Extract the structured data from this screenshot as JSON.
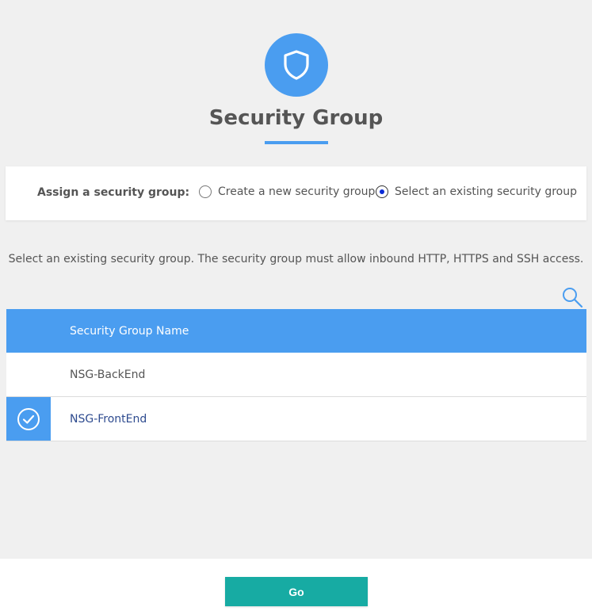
{
  "header": {
    "icon": "shield-icon",
    "title": "Security Group"
  },
  "assign": {
    "label": "Assign a security group:",
    "options": [
      {
        "label": "Create a new security group",
        "selected": false
      },
      {
        "label": "Select an existing security group",
        "selected": true
      }
    ]
  },
  "instructions": "Select an existing security group. The security group must allow inbound HTTP, HTTPS and SSH access.",
  "search": {
    "icon": "search-icon"
  },
  "table": {
    "column_header": "Security Group Name",
    "rows": [
      {
        "name": "NSG-BackEnd",
        "selected": false
      },
      {
        "name": "NSG-FrontEnd",
        "selected": true
      }
    ]
  },
  "footer": {
    "go_label": "Go"
  },
  "colors": {
    "accent": "#4a9df0",
    "primary_button": "#17aba3",
    "radio_selected": "#0b2bd6",
    "background": "#f0f0f0"
  }
}
